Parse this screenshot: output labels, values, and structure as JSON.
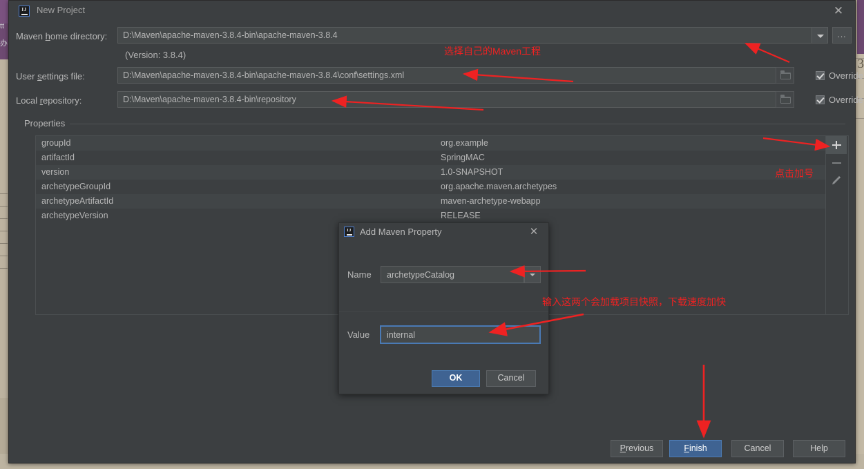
{
  "desktop": {
    "left_strip_text_1": "tt",
    "left_strip_text_2": "办",
    "right_number": "3"
  },
  "window": {
    "title": "New Project",
    "logo_text": "IJ",
    "close_icon": "close-icon"
  },
  "form": {
    "maven_home_label_pre": "Maven ",
    "maven_home_label_mnemonic": "h",
    "maven_home_label_post": "ome directory:",
    "maven_home_value": "D:\\Maven\\apache-maven-3.8.4-bin\\apache-maven-3.8.4",
    "version_text": "(Version: 3.8.4)",
    "user_settings_label_pre": "User ",
    "user_settings_label_mnemonic": "s",
    "user_settings_label_post": "ettings file:",
    "user_settings_value": "D:\\Maven\\apache-maven-3.8.4-bin\\apache-maven-3.8.4\\conf\\settings.xml",
    "local_repo_label_pre": "Local ",
    "local_repo_label_mnemonic": "r",
    "local_repo_label_post": "epository:",
    "local_repo_value": "D:\\Maven\\apache-maven-3.8.4-bin\\repository",
    "browse_button_label": "...",
    "override_label_1": "Override",
    "override_label_2": "Override"
  },
  "properties": {
    "legend": "Properties",
    "rows": [
      {
        "key": "groupId",
        "value": "org.example"
      },
      {
        "key": "artifactId",
        "value": "SpringMAC"
      },
      {
        "key": "version",
        "value": "1.0-SNAPSHOT"
      },
      {
        "key": "archetypeGroupId",
        "value": "org.apache.maven.archetypes"
      },
      {
        "key": "archetypeArtifactId",
        "value": "maven-archetype-webapp"
      },
      {
        "key": "archetypeVersion",
        "value": "RELEASE"
      }
    ],
    "toolbar": {
      "add_icon": "plus-icon",
      "remove_icon": "minus-icon",
      "edit_icon": "pencil-icon"
    }
  },
  "dialog": {
    "title": "Add Maven Property",
    "logo_text": "IJ",
    "name_label": "Name",
    "name_value": "archetypeCatalog",
    "value_label": "Value",
    "value_value": "internal",
    "ok_label": "OK",
    "cancel_label": "Cancel"
  },
  "wizard_buttons": {
    "previous_pre": "",
    "previous_mnemonic": "P",
    "previous_post": "revious",
    "finish_pre": "",
    "finish_mnemonic": "F",
    "finish_post": "inish",
    "cancel": "Cancel",
    "help": "Help"
  },
  "annotations": {
    "select_maven_project": "选择自己的Maven工程",
    "click_plus": "点击加号",
    "input_these_two": "输入这两个会加载项目快照，下载速度加快"
  },
  "colors": {
    "accent_blue": "#3f6392",
    "annotation_red": "#ee2222",
    "window_bg": "#3c3f41",
    "field_bg": "#45494a"
  }
}
